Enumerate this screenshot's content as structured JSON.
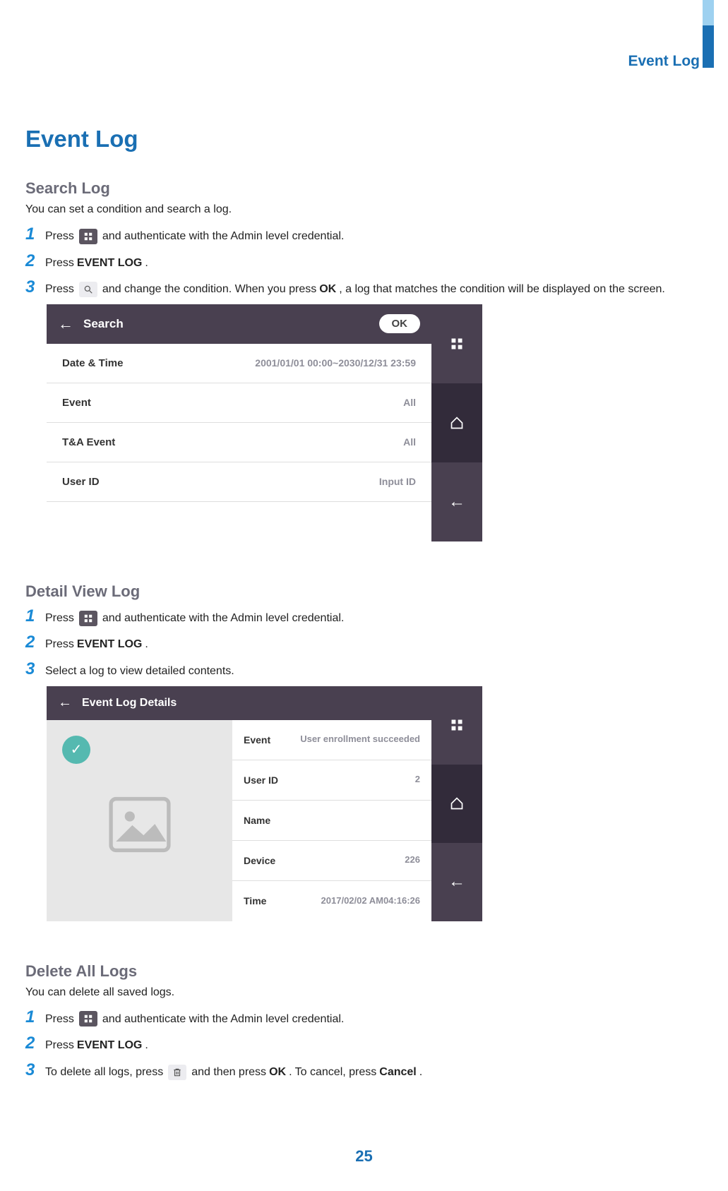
{
  "header": {
    "section_label": "Event Log"
  },
  "page_title": "Event Log",
  "page_number": "25",
  "search_log": {
    "heading": "Search Log",
    "intro": "You can set a condition and search a log.",
    "steps": {
      "s1_a": "Press",
      "s1_b": "and authenticate with the Admin level credential.",
      "s2_a": "Press",
      "s2_bold": "EVENT LOG",
      "s2_b": ".",
      "s3_a": "Press",
      "s3_b": "and change the condition. When you press",
      "s3_bold": "OK",
      "s3_c": ", a log that matches the condition will be displayed on the screen."
    },
    "mock": {
      "title": "Search",
      "ok": "OK",
      "rows": [
        {
          "label": "Date & Time",
          "value": "2001/01/01 00:00~2030/12/31 23:59"
        },
        {
          "label": "Event",
          "value": "All"
        },
        {
          "label": "T&A Event",
          "value": "All"
        },
        {
          "label": "User ID",
          "value": "Input ID"
        }
      ]
    }
  },
  "detail_view": {
    "heading": "Detail View Log",
    "steps": {
      "s1_a": "Press",
      "s1_b": "and authenticate with the Admin level credential.",
      "s2_a": "Press",
      "s2_bold": "EVENT LOG",
      "s2_b": ".",
      "s3": "Select a log to view detailed contents."
    },
    "mock": {
      "title": "Event Log Details",
      "rows": [
        {
          "label": "Event",
          "value": "User enrollment succeeded"
        },
        {
          "label": "User ID",
          "value": "2"
        },
        {
          "label": "Name",
          "value": ""
        },
        {
          "label": "Device",
          "value": "226"
        },
        {
          "label": "Time",
          "value": "2017/02/02 AM04:16:26"
        }
      ]
    }
  },
  "delete_all": {
    "heading": "Delete All Logs",
    "intro": "You can delete all saved logs.",
    "steps": {
      "s1_a": "Press",
      "s1_b": "and authenticate with the Admin level credential.",
      "s2_a": "Press",
      "s2_bold": "EVENT LOG",
      "s2_b": ".",
      "s3_a": "To delete all logs, press",
      "s3_b": "and then press",
      "s3_bold1": "OK",
      "s3_c": ". To cancel, press",
      "s3_bold2": "Cancel",
      "s3_d": "."
    }
  }
}
